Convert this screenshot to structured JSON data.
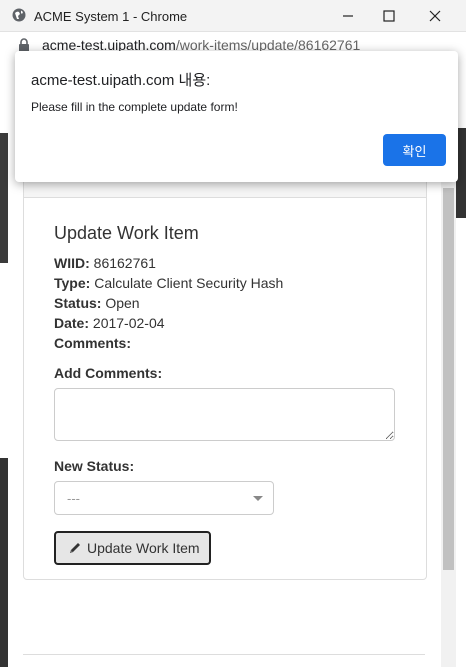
{
  "window": {
    "title": "ACME System 1 - Chrome",
    "minimize_glyph": "—",
    "maximize_glyph": "☐",
    "close_glyph": "✕"
  },
  "address_bar": {
    "url_host": "acme-test.uipath.com",
    "url_path": "/work-items/update/86162761"
  },
  "dialog": {
    "title": "acme-test.uipath.com 내용:",
    "message": "Please fill in the complete update form!",
    "ok_label": "확인",
    "ok_color": "#1a73e8"
  },
  "form": {
    "title": "Update Work Item",
    "wiid_label": "WIID:",
    "wiid_value": "86162761",
    "type_label": "Type:",
    "type_value": "Calculate Client Security Hash",
    "status_label": "Status:",
    "status_value": "Open",
    "date_label": "Date:",
    "date_value": "2017-02-04",
    "comments_label": "Comments:",
    "add_comments_label": "Add Comments:",
    "add_comments_value": "",
    "new_status_label": "New Status:",
    "new_status_value": "---",
    "update_button_label": "Update Work Item",
    "update_button_icon": "pencil-icon"
  },
  "colors": {
    "dialog_button": "#1a73e8",
    "scroll_thumb": "#c1c1c1"
  }
}
